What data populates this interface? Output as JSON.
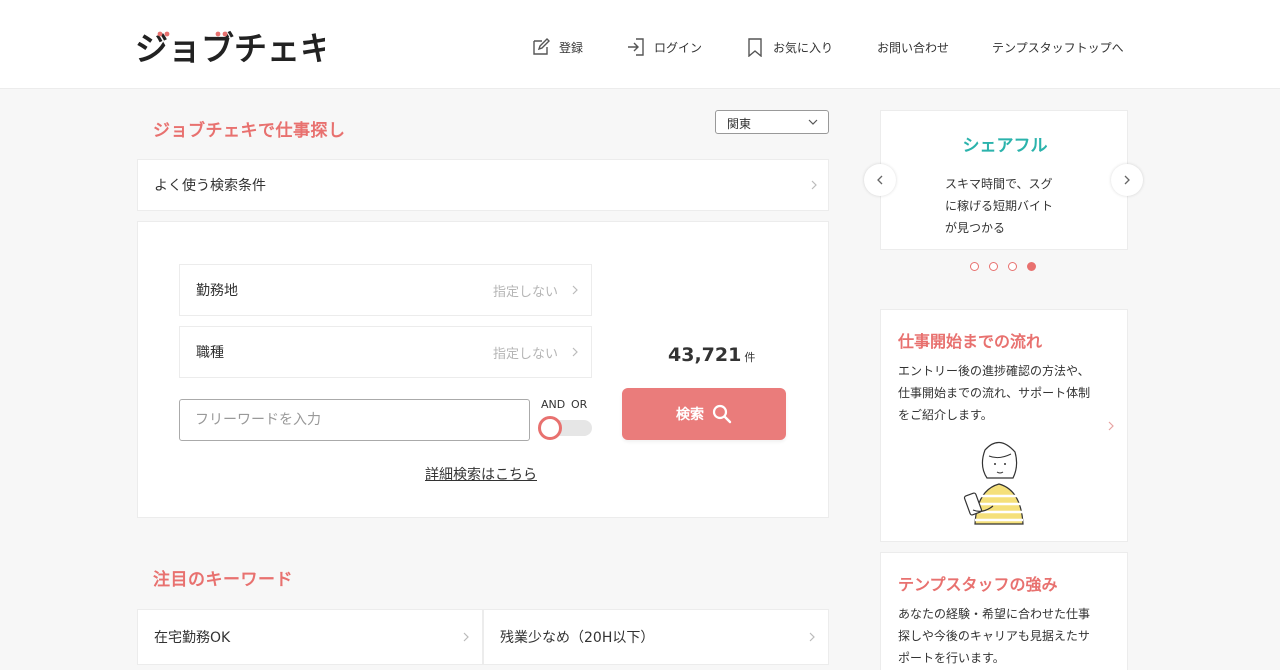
{
  "header": {
    "logo_text": "ジョブチェキ",
    "nav": [
      {
        "label": "登録",
        "icon": "edit-icon"
      },
      {
        "label": "ログイン",
        "icon": "login-icon"
      },
      {
        "label": "お気に入り",
        "icon": "bookmark-icon"
      },
      {
        "label": "お問い合わせ"
      },
      {
        "label": "テンプスタッフトップへ"
      }
    ]
  },
  "search": {
    "title": "ジョブチェキで仕事探し",
    "region": "関東",
    "frequent_label": "よく使う検索条件",
    "fields": [
      {
        "label": "勤務地",
        "value": "指定しない"
      },
      {
        "label": "職種",
        "value": "指定しない"
      }
    ],
    "freeword_placeholder": "フリーワードを入力",
    "and_label": "AND",
    "or_label": "OR",
    "count": "43,721",
    "count_unit": "件",
    "button_label": "検索",
    "detail_link": "詳細検索はこちら"
  },
  "keywords": {
    "title": "注目のキーワード",
    "items": [
      "在宅勤務OK",
      "残業少なめ（20H以下）"
    ]
  },
  "sidebar": {
    "slider": {
      "title": "シェアフル",
      "text_lines": [
        "スキマ時間で、スグ",
        "に稼げる短期バイト",
        "が見つかる"
      ],
      "dot_count": 4,
      "active_dot": 4
    },
    "cards": [
      {
        "title": "仕事開始までの流れ",
        "desc_lines": [
          "エントリー後の進捗確認の方法や、",
          "仕事開始までの流れ、サポート体制",
          "をご紹介します。"
        ]
      },
      {
        "title": "テンプスタッフの強み",
        "desc_lines": [
          "あなたの経験・希望に合わせた仕事",
          "探しや今後のキャリアも見据えたサ",
          "ポートを行います。"
        ]
      }
    ]
  },
  "colors": {
    "accent": "#e8716f",
    "button": "#ea7c7b",
    "teal": "#2bb3ac",
    "background": "#f7f7f7"
  }
}
